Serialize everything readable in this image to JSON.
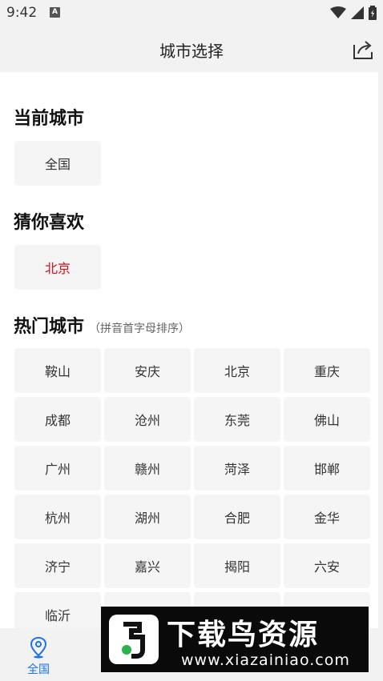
{
  "status_bar": {
    "time": "9:42",
    "notification_letter": "A"
  },
  "header": {
    "title": "城市选择",
    "share_icon": "share-icon"
  },
  "current_city": {
    "title": "当前城市",
    "value": "全国"
  },
  "guess": {
    "title": "猜你喜欢",
    "value": "北京",
    "accent_color": "#d0111b"
  },
  "hot": {
    "title": "热门城市",
    "subtitle": "（拼音首字母排序）",
    "cities": [
      "鞍山",
      "安庆",
      "北京",
      "重庆",
      "成都",
      "沧州",
      "东莞",
      "佛山",
      "广州",
      "赣州",
      "菏泽",
      "邯郸",
      "杭州",
      "湖州",
      "合肥",
      "金华",
      "济宁",
      "嘉兴",
      "揭阳",
      "六安",
      "临沂"
    ]
  },
  "bottom_nav": {
    "first_label": "全国",
    "accent_color": "#1a73e8"
  },
  "watermark": {
    "title": "下载鸟资源",
    "url": "www.xiazainiao.com"
  }
}
